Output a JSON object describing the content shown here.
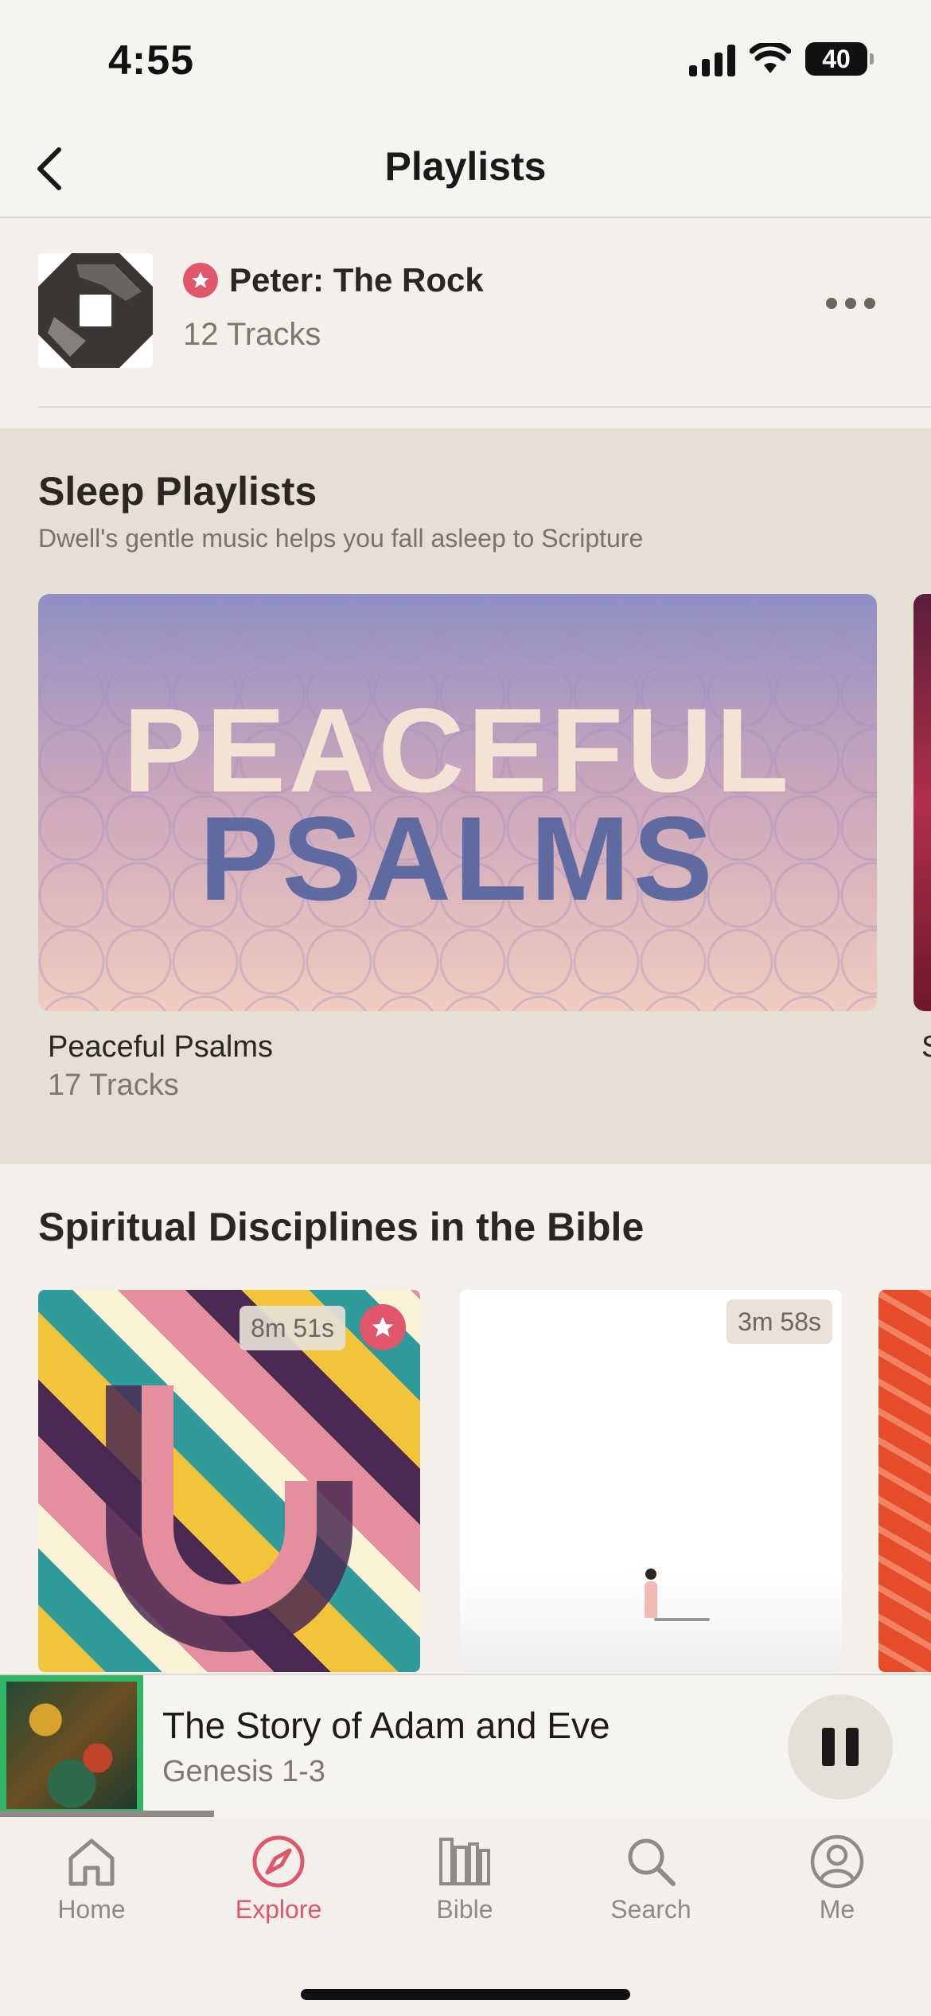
{
  "status_bar": {
    "time": "4:55",
    "battery": "40"
  },
  "header": {
    "title": "Playlists"
  },
  "playlist": {
    "title": "Peter: The Rock",
    "tracks": "12 Tracks"
  },
  "sleep": {
    "title": "Sleep Playlists",
    "subtitle": "Dwell's gentle music helps you fall asleep to Scripture",
    "card": {
      "art_line1": "PEACEFUL",
      "art_line2": "PSALMS",
      "title": "Peaceful Psalms",
      "tracks": "17 Tracks"
    },
    "peek_letter": "S"
  },
  "disciplines": {
    "title": "Spiritual Disciplines in the Bible",
    "cards": [
      {
        "duration": "8m 51s",
        "favorited": true
      },
      {
        "duration": "3m 58s",
        "favorited": false
      }
    ]
  },
  "now_playing": {
    "title": "The Story of Adam and Eve",
    "subtitle": "Genesis 1-3",
    "progress": 0.23
  },
  "tabs": [
    {
      "label": "Home",
      "icon": "home-icon",
      "active": false
    },
    {
      "label": "Explore",
      "icon": "compass-icon",
      "active": true
    },
    {
      "label": "Bible",
      "icon": "bible-icon",
      "active": false
    },
    {
      "label": "Search",
      "icon": "search-icon",
      "active": false
    },
    {
      "label": "Me",
      "icon": "profile-icon",
      "active": false
    }
  ],
  "colors": {
    "accent": "#e0566b",
    "sleep_bg": "#e6dfd6",
    "page_bg": "#f3f0ec"
  }
}
